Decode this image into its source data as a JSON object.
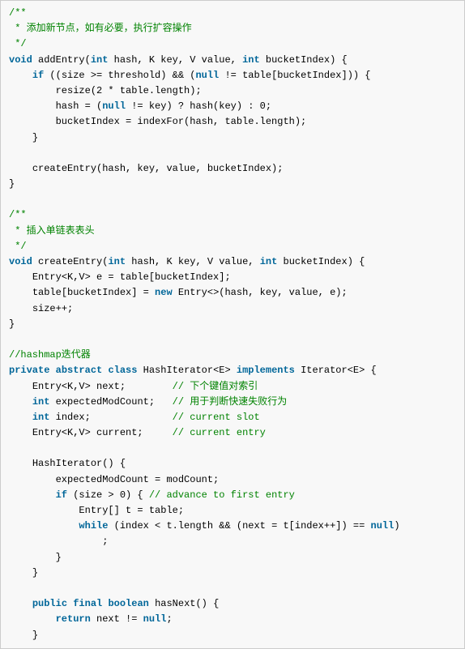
{
  "code": {
    "doc1_l1": "/**",
    "doc1_l2": " * 添加新节点，如有必要，执行扩容操作",
    "doc1_l3": " */",
    "kw_void": "void",
    "kw_int": "int",
    "kw_if": "if",
    "kw_null": "null",
    "kw_new": "new",
    "kw_private": "private",
    "kw_abstract": "abstract",
    "kw_class": "class",
    "kw_implements": "implements",
    "kw_while": "while",
    "kw_public": "public",
    "kw_final": "final",
    "kw_boolean": "boolean",
    "kw_return": "return",
    "addEntry_sig_a": " addEntry(",
    "addEntry_sig_b": " hash, K key, V value, ",
    "addEntry_sig_c": " bucketIndex) {",
    "if_cond_a": " ((size >= threshold) && (",
    "if_cond_b": " != table[bucketIndex])) {",
    "resize_call": "resize(2 * table.length);",
    "hash_assign_a": "hash = (",
    "hash_assign_b": " != key) ? hash(key) : 0;",
    "bucket_assign": "bucketIndex = indexFor(hash, table.length);",
    "close_brace": "}",
    "createEntry_call": "createEntry(hash, key, value, bucketIndex);",
    "doc2_l1": "/**",
    "doc2_l2": " * 插入单链表表头",
    "doc2_l3": " */",
    "createEntry_sig_a": " createEntry(",
    "createEntry_sig_b": " hash, K key, V value, ",
    "createEntry_sig_c": " bucketIndex) {",
    "entry_decl": "Entry<K,V> e = table[bucketIndex];",
    "table_assign_a": "table[bucketIndex] = ",
    "table_assign_b": " Entry<>(hash, key, value, e);",
    "sizepp": "size++;",
    "cm_hashmap": "//hashmap迭代器",
    "hi_sig_a": " HashIterator<E> ",
    "hi_sig_b": " Iterator<E> {",
    "next_decl": "Entry<K,V> next;",
    "cm_next": "// 下个键值对索引",
    "expmc_decl_a": " expectedModCount;",
    "cm_expmc": "// 用于判断快速失败行为",
    "index_decl_a": " index;",
    "cm_index": "// current slot",
    "current_decl": "Entry<K,V> current;",
    "cm_current": "// current entry",
    "hi_ctor": "HashIterator() {",
    "expmc_assign": "expectedModCount = modCount;",
    "if_size_a": " (size > 0) { ",
    "cm_advance": "// advance to first entry",
    "entry_t": "Entry[] t = table;",
    "while_body_a": " (index < t.length && (next = t[index++]) == ",
    "while_body_b": ")",
    "semi": ";",
    "hasNext_sig": " hasNext() {",
    "return_next_a": " next != ",
    "return_next_b": ";"
  }
}
